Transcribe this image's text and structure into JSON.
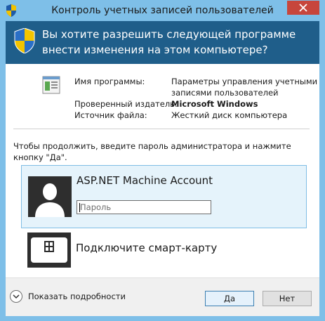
{
  "window": {
    "title": "Контроль учетных записей пользователей",
    "accent": "#7ebfe8",
    "banner_color": "#1f5e8a"
  },
  "banner": {
    "question": "Вы хотите разрешить следующей программе внести изменения на этом компьютере?"
  },
  "program_info": {
    "program_name_label": "Имя программы:",
    "program_name_value": "Параметры управления учетными записями пользователей",
    "publisher_label": "Проверенный издатель:",
    "publisher_value": "Microsoft Windows",
    "source_label": "Источник файла:",
    "source_value": "Жесткий диск компьютера"
  },
  "instruction": "Чтобы продолжить, введите пароль администратора и нажмите кнопку \"Да\".",
  "accounts": [
    {
      "name": "ASP.NET Machine Account",
      "password_placeholder": "Пароль",
      "password_value": "",
      "icon": "user-avatar-icon"
    }
  ],
  "smart_card": {
    "label": "Подключите смарт-карту",
    "icon": "smart-card-icon"
  },
  "footer": {
    "details_label": "Показать подробности",
    "yes_label": "Да",
    "no_label": "Нет"
  }
}
